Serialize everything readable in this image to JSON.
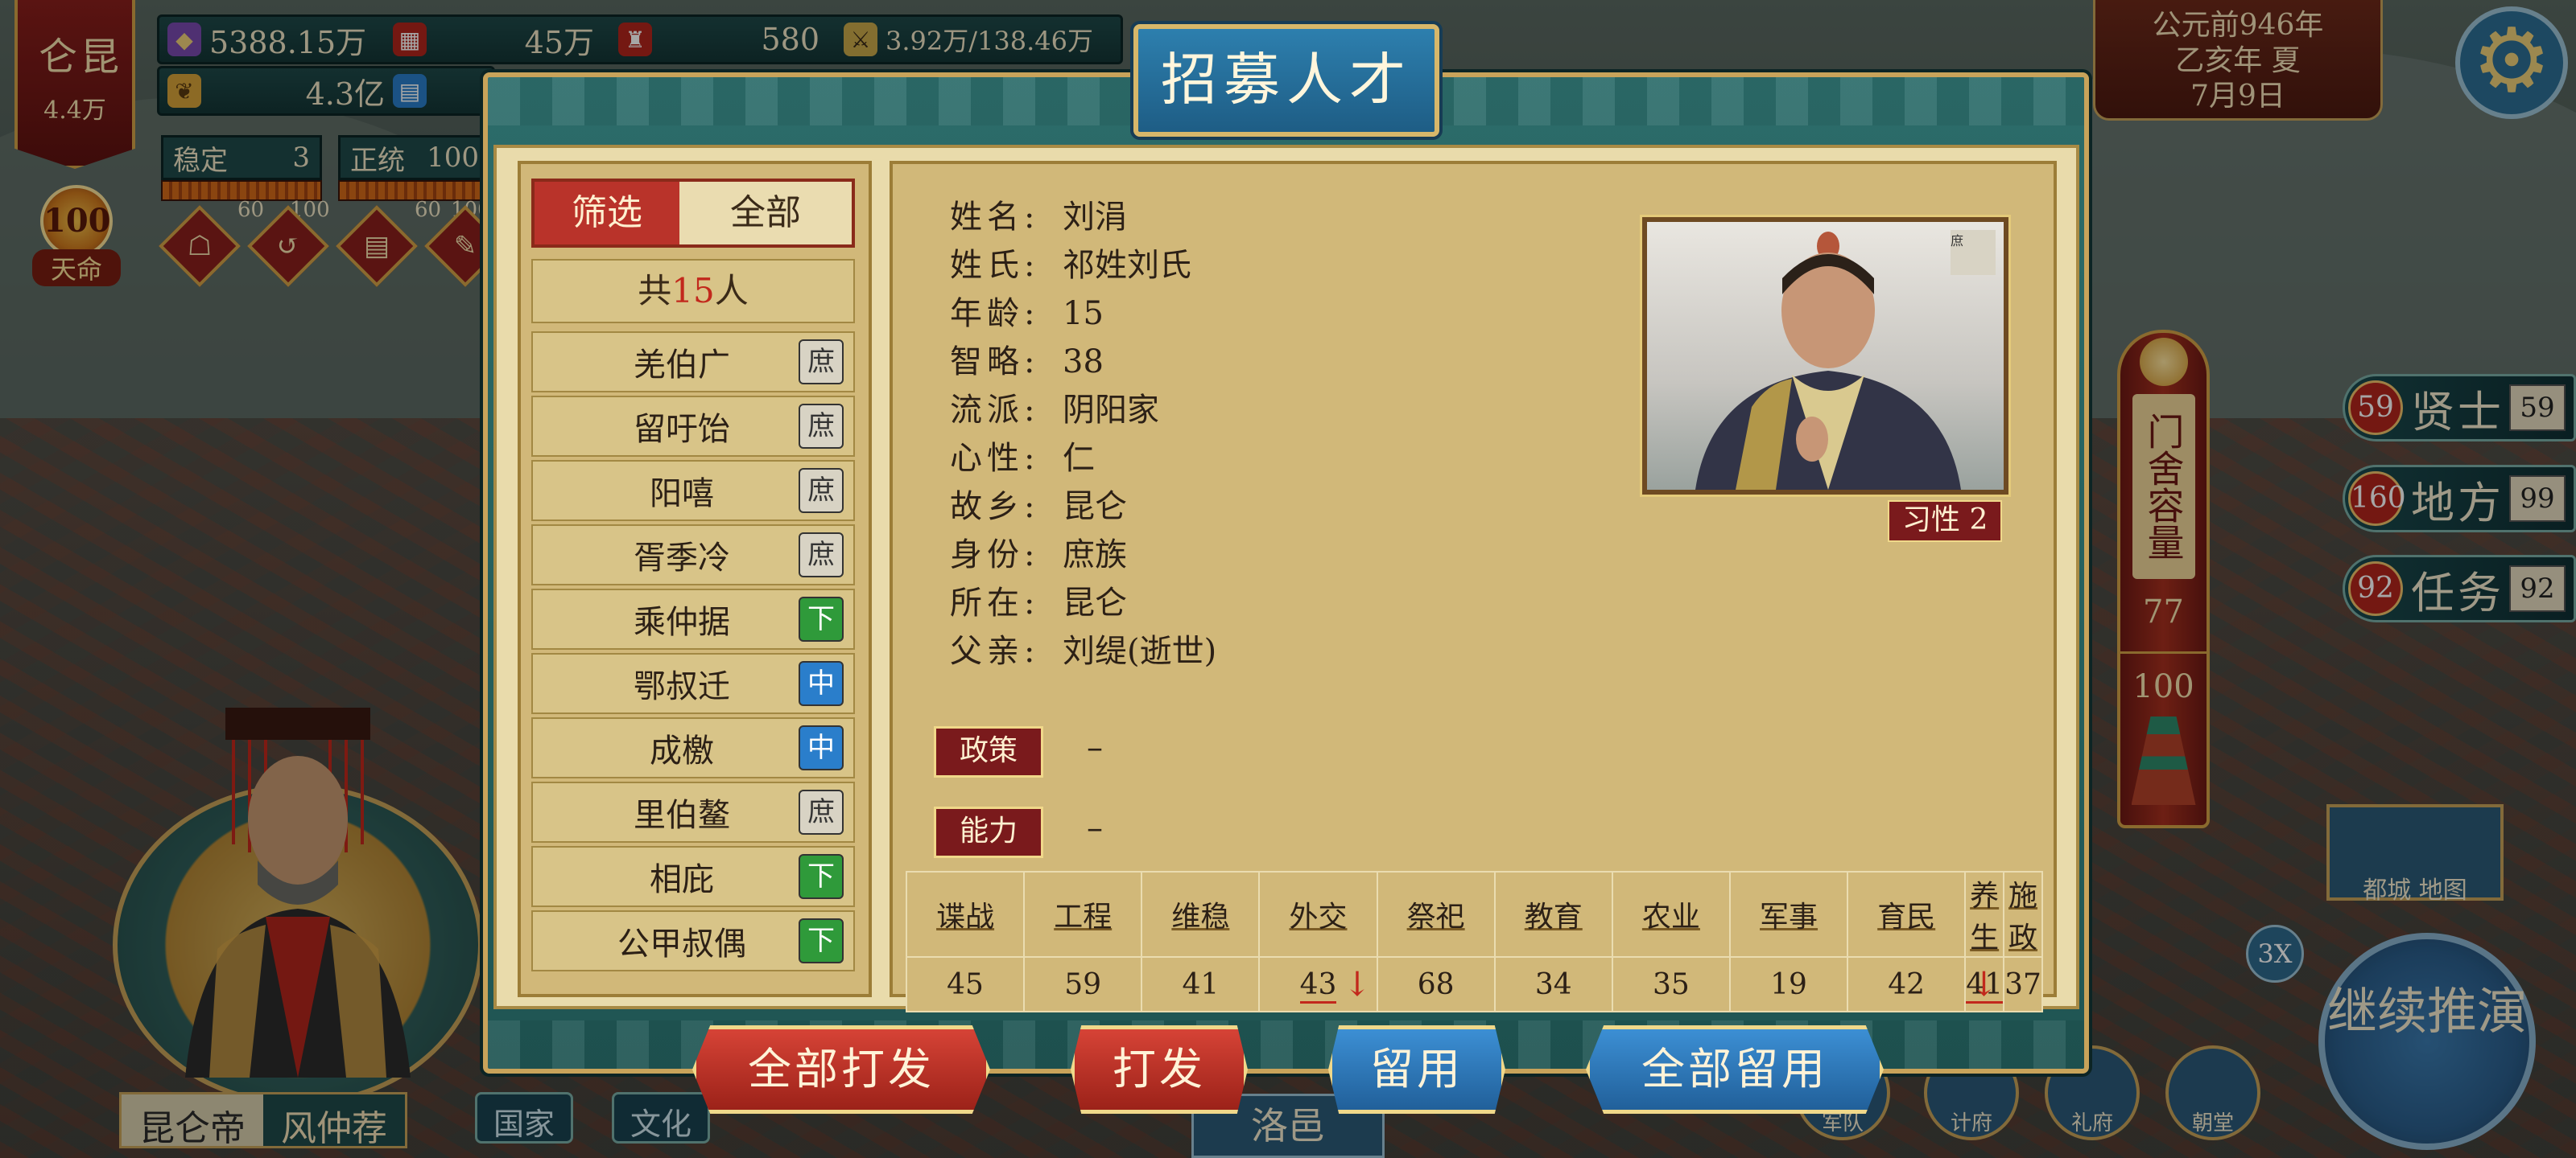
{
  "kingdom": {
    "name": "昆仑",
    "population": "4.4万"
  },
  "mandate": {
    "value": "100",
    "label": "天命"
  },
  "resources": {
    "gold": "5388.15万",
    "grain_stock": "45万",
    "soldiers": "580",
    "troops": "3.92万/138.46万",
    "food": "4.3亿"
  },
  "stats": [
    {
      "label": "稳定",
      "value": "3",
      "min": "60",
      "max": "100"
    },
    {
      "label": "正统",
      "value": "100",
      "min": "60",
      "max": "100"
    }
  ],
  "date": {
    "era": "公元前946年",
    "year": "乙亥年 夏",
    "day": "7月9日"
  },
  "right_panel": {
    "capacity_label": "门舍容量",
    "capacity_current": "77",
    "capacity_max": "100",
    "buttons": [
      {
        "badge": "59",
        "label": "贤士",
        "count": "59"
      },
      {
        "badge": "160",
        "label": "地方",
        "count": "99"
      },
      {
        "badge": "92",
        "label": "任务",
        "count": "92"
      }
    ],
    "city_map": "都城 地图",
    "speed": "3X",
    "continue": "继续推演"
  },
  "bottom_icons": [
    "军队",
    "计府",
    "礼府",
    "朝堂"
  ],
  "ruler": {
    "title": "昆仑帝",
    "name": "风仲荐"
  },
  "bottom_tabs": [
    "国家",
    "文化"
  ],
  "city": "洛邑",
  "dialog": {
    "title": "招募人才",
    "filter_label": "筛选",
    "filter_value": "全部",
    "total_prefix": "共",
    "total_count": "15",
    "total_suffix": "人",
    "candidates": [
      {
        "name": "羌伯广",
        "tag": "庶",
        "tier": "commoner"
      },
      {
        "name": "留吁饴",
        "tag": "庶",
        "tier": "commoner"
      },
      {
        "name": "阳嘻",
        "tag": "庶",
        "tier": "commoner"
      },
      {
        "name": "胥季冷",
        "tag": "庶",
        "tier": "commoner"
      },
      {
        "name": "乘仲据",
        "tag": "下",
        "tier": "low"
      },
      {
        "name": "鄂叔迁",
        "tag": "中",
        "tier": "mid"
      },
      {
        "name": "成檄",
        "tag": "中",
        "tier": "mid"
      },
      {
        "name": "里伯鳌",
        "tag": "庶",
        "tier": "commoner"
      },
      {
        "name": "相庇",
        "tag": "下",
        "tier": "low"
      },
      {
        "name": "公甲叔偶",
        "tag": "下",
        "tier": "low"
      }
    ],
    "details": [
      {
        "key": "姓名:",
        "value": "刘涓"
      },
      {
        "key": "姓氏:",
        "value": "祁姓刘氏"
      },
      {
        "key": "年龄:",
        "value": "15"
      },
      {
        "key": "智略:",
        "value": "38"
      },
      {
        "key": "流派:",
        "value": "阴阳家"
      },
      {
        "key": "心性:",
        "value": "仁"
      },
      {
        "key": "故乡:",
        "value": "昆仑"
      },
      {
        "key": "身份:",
        "value": "庶族"
      },
      {
        "key": "所在:",
        "value": "昆仑"
      },
      {
        "key": "父亲:",
        "value": "刘缇(逝世)"
      }
    ],
    "portrait_tag": "庶",
    "trait": "习性 2",
    "policy_label": "政策",
    "policy_value": "–",
    "ability_label": "能力",
    "ability_value": "–",
    "skills": {
      "headers": [
        "谍战",
        "工程",
        "维稳",
        "外交",
        "祭祀",
        "教育",
        "农业",
        "军事",
        "育民",
        "养生",
        "施政"
      ],
      "values": [
        "45",
        "59",
        "41",
        "43",
        "68",
        "34",
        "35",
        "19",
        "42",
        "41",
        "37"
      ],
      "down_flags": [
        false,
        false,
        false,
        true,
        false,
        false,
        false,
        false,
        false,
        true,
        false
      ]
    },
    "actions": {
      "dismiss_all": "全部打发",
      "dismiss": "打发",
      "retain": "留用",
      "retain_all": "全部留用"
    }
  }
}
